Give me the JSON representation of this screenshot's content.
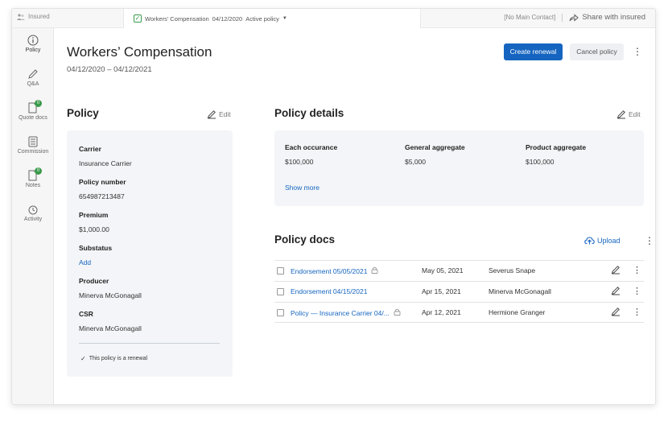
{
  "topbar": {
    "insured_label": "Insured",
    "tab_title": "Workers' Compensation",
    "tab_date": "04/12/2020",
    "tab_status": "Active policy",
    "main_contact": "[No Main Contact]",
    "share_label": "Share with insured"
  },
  "sidebar": {
    "items": [
      {
        "label": "Policy",
        "icon": "info-icon"
      },
      {
        "label": "Q&A",
        "icon": "pen-icon"
      },
      {
        "label": "Quote docs",
        "icon": "doc-icon",
        "badge": "0"
      },
      {
        "label": "Commission",
        "icon": "calculator-icon"
      },
      {
        "label": "Notes",
        "icon": "note-icon",
        "badge": "0"
      },
      {
        "label": "Activity",
        "icon": "activity-icon"
      }
    ]
  },
  "header": {
    "title": "Workers’ Compensation",
    "dates": "04/12/2020 – 04/12/2021",
    "create_renewal": "Create renewal",
    "cancel_policy": "Cancel policy"
  },
  "policy": {
    "heading": "Policy",
    "edit": "Edit",
    "fields": [
      {
        "label": "Carrier",
        "value": "Insurance Carrier"
      },
      {
        "label": "Policy number",
        "value": "654987213487"
      },
      {
        "label": "Premium",
        "value": "$1,000.00"
      },
      {
        "label": "Substatus",
        "value": "Add"
      },
      {
        "label": "Producer",
        "value": "Minerva McGonagall"
      },
      {
        "label": "CSR",
        "value": "Minerva McGonagall"
      }
    ],
    "renewal_note": "This policy is a renewal"
  },
  "details": {
    "heading": "Policy details",
    "edit": "Edit",
    "columns": [
      {
        "label": "Each occurance",
        "value": "$100,000"
      },
      {
        "label": "General aggregate",
        "value": "$5,000"
      },
      {
        "label": "Product aggregate",
        "value": "$100,000"
      }
    ],
    "show_more": "Show more"
  },
  "docs": {
    "heading": "Policy docs",
    "upload": "Upload",
    "rows": [
      {
        "name": "Endorsement 05/05/2021",
        "locked": true,
        "date": "May 05, 2021",
        "user": "Severus Snape"
      },
      {
        "name": "Endorsement 04/15/2021",
        "locked": false,
        "date": "Apr 15, 2021",
        "user": "Minerva McGonagall"
      },
      {
        "name": "Policy — Insurance Carrier 04/...",
        "locked": true,
        "date": "Apr 12, 2021",
        "user": "Hermione Granger"
      }
    ]
  },
  "colors": {
    "accent": "#1565c0",
    "badge": "#3a9a4a",
    "card_bg": "#f3f5f8"
  }
}
